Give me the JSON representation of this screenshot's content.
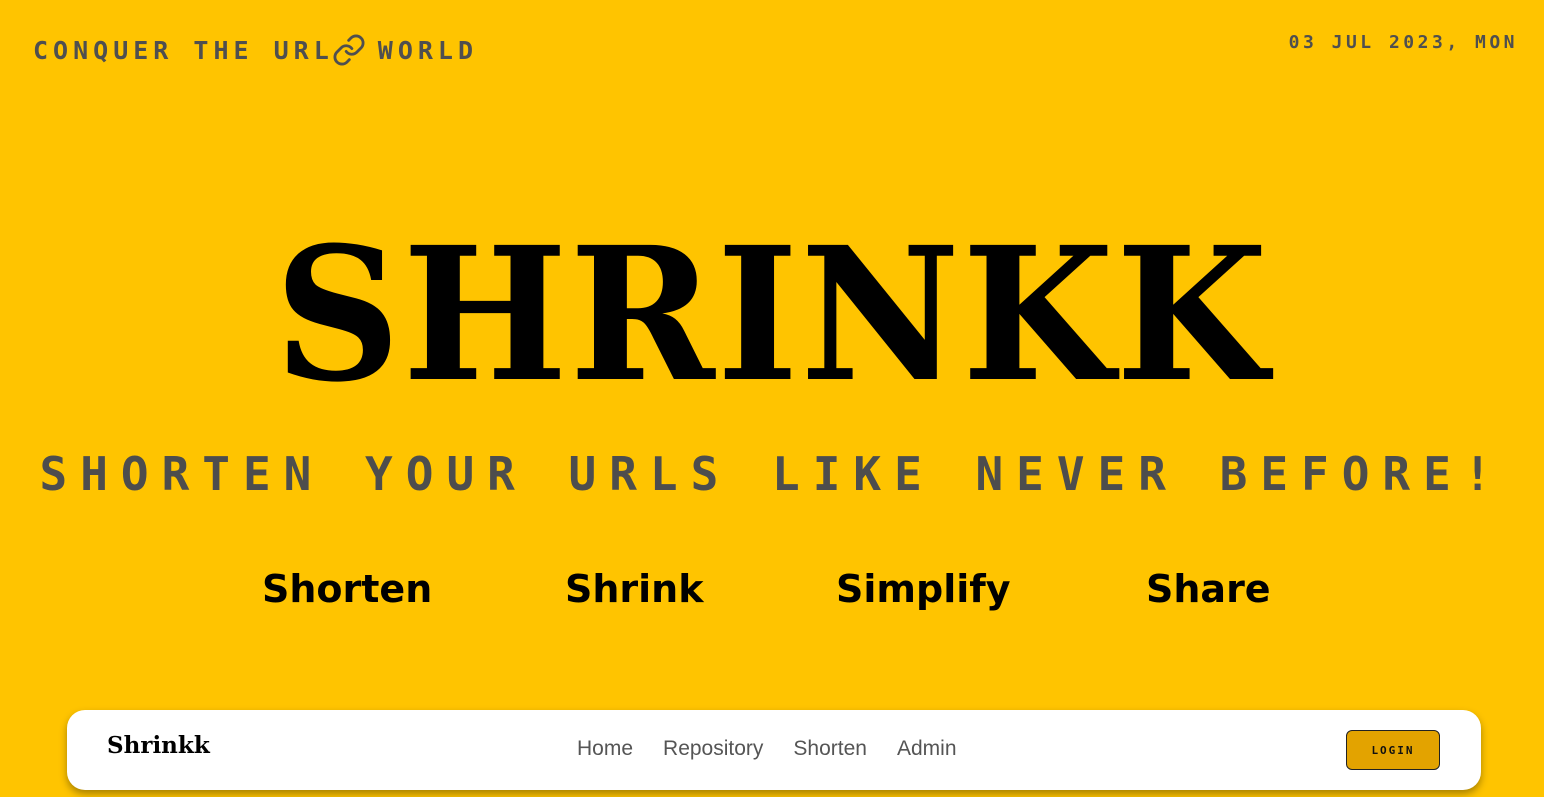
{
  "header": {
    "tagline_before": "Conquer the URL",
    "tagline_icon": "link-icon",
    "tagline_after": "World",
    "date": "03 Jul 2023, Mon"
  },
  "hero": {
    "title": "SHRINKK",
    "subtitle": "Shorten your URLs like never before!"
  },
  "features": [
    "Shorten",
    "Shrink",
    "Simplify",
    "Share"
  ],
  "navbar": {
    "brand": "Shrinkk",
    "links": [
      "Home",
      "Repository",
      "Shorten",
      "Admin"
    ],
    "login_label": "Login"
  },
  "colors": {
    "background": "#FFC400",
    "text_dark": "#000000",
    "text_muted": "#4f4f4f",
    "login_button": "#E3A300",
    "navbar_bg": "#FFFFFF"
  }
}
